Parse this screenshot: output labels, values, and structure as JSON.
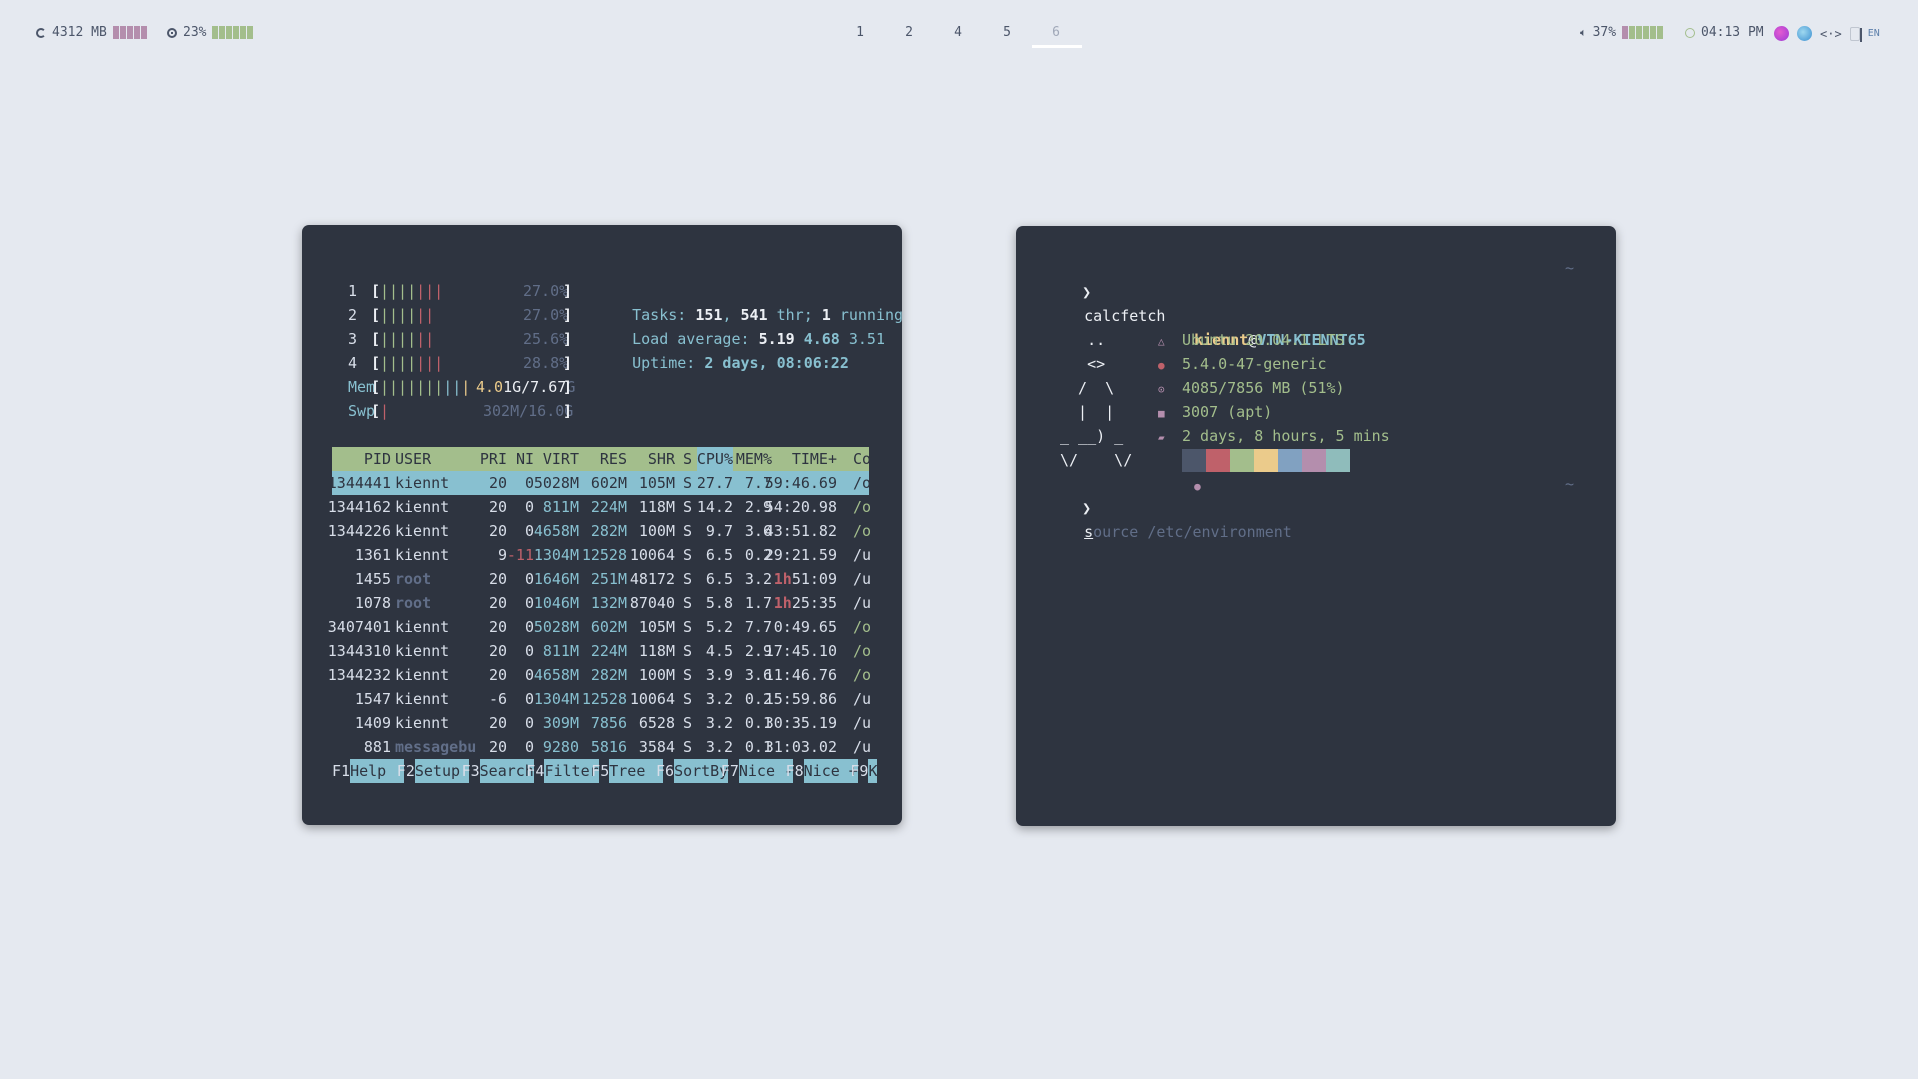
{
  "topbar": {
    "memory": {
      "icon": "memory-icon",
      "label": "4312 MB"
    },
    "cpu": {
      "icon": "cpu-icon",
      "label": "23%"
    },
    "workspaces": [
      "1",
      "2",
      "4",
      "5",
      "6"
    ],
    "active_workspace": "6",
    "volume": {
      "icon": "volume-icon",
      "label": "37%"
    },
    "clock": {
      "icon": "clock-icon",
      "label": "04:13 PM"
    },
    "tray_icons": [
      "firefox-icon",
      "globe-icon",
      "network-icon",
      "battery-icon"
    ],
    "keyboard_layout": "EN"
  },
  "htop": {
    "cpu_meters": [
      {
        "id": "1",
        "percent": "27.0%"
      },
      {
        "id": "2",
        "percent": "27.0%"
      },
      {
        "id": "3",
        "percent": "25.6%"
      },
      {
        "id": "4",
        "percent": "28.8%"
      }
    ],
    "mem_label": "Mem",
    "mem_value_a": "4.0",
    "mem_value_b": "1G/7.67",
    "mem_value_c": "G",
    "swp_label": "Swp",
    "swp_value": "302M/16.0G",
    "tasks_label": "Tasks: ",
    "tasks_total": "151",
    "tasks_thr": "541",
    "tasks_thr_label": " thr; ",
    "tasks_running": "1",
    "tasks_running_label": " running",
    "load_label": "Load average: ",
    "load_1": "5.19",
    "load_5": "4.68",
    "load_15": "3.51",
    "uptime_label": "Uptime: ",
    "uptime_value": "2 days, 08:06:22",
    "columns": [
      "PID",
      "USER",
      "PRI",
      "NI",
      "VIRT",
      "RES",
      "SHR",
      "S",
      "CPU%",
      "MEM%",
      "TIME+",
      "Co"
    ],
    "processes": [
      {
        "pid": "1344441",
        "user": "kiennt",
        "pri": "20",
        "ni": "0",
        "virt": "5028M",
        "res": "602M",
        "shr": "105M",
        "s": "S",
        "cpu": "27.7",
        "mem": "7.7",
        "time": "59:46.69",
        "cmd": "/o"
      },
      {
        "pid": "1344162",
        "user": "kiennt",
        "pri": "20",
        "ni": "0",
        "virt": "811M",
        "res": "224M",
        "shr": "118M",
        "s": "S",
        "cpu": "14.2",
        "mem": "2.9",
        "time": "54:20.98",
        "cmd": "/o"
      },
      {
        "pid": "1344226",
        "user": "kiennt",
        "pri": "20",
        "ni": "0",
        "virt": "4658M",
        "res": "282M",
        "shr": "100M",
        "s": "S",
        "cpu": "9.7",
        "mem": "3.6",
        "time": "43:51.82",
        "cmd": "/o"
      },
      {
        "pid": "1361",
        "user": "kiennt",
        "pri": "9",
        "ni": "-11",
        "virt": "1304M",
        "res": "12528",
        "shr": "10064",
        "s": "S",
        "cpu": "6.5",
        "mem": "0.2",
        "time": "29:21.59",
        "cmd": "/u"
      },
      {
        "pid": "1455",
        "user": "root",
        "pri": "20",
        "ni": "0",
        "virt": "1646M",
        "res": "251M",
        "shr": "48172",
        "s": "S",
        "cpu": "6.5",
        "mem": "3.2",
        "time_h": "1h",
        "time": "51:09",
        "cmd": "/u"
      },
      {
        "pid": "1078",
        "user": "root",
        "pri": "20",
        "ni": "0",
        "virt": "1046M",
        "res": "132M",
        "shr": "87040",
        "s": "S",
        "cpu": "5.8",
        "mem": "1.7",
        "time_h": "1h",
        "time": "25:35",
        "cmd": "/u"
      },
      {
        "pid": "3407401",
        "user": "kiennt",
        "pri": "20",
        "ni": "0",
        "virt": "5028M",
        "res": "602M",
        "shr": "105M",
        "s": "S",
        "cpu": "5.2",
        "mem": "7.7",
        "time": "0:49.65",
        "cmd": "/o"
      },
      {
        "pid": "1344310",
        "user": "kiennt",
        "pri": "20",
        "ni": "0",
        "virt": "811M",
        "res": "224M",
        "shr": "118M",
        "s": "S",
        "cpu": "4.5",
        "mem": "2.9",
        "time": "17:45.10",
        "cmd": "/o"
      },
      {
        "pid": "1344232",
        "user": "kiennt",
        "pri": "20",
        "ni": "0",
        "virt": "4658M",
        "res": "282M",
        "shr": "100M",
        "s": "S",
        "cpu": "3.9",
        "mem": "3.6",
        "time": "11:46.76",
        "cmd": "/o"
      },
      {
        "pid": "1547",
        "user": "kiennt",
        "pri": "-6",
        "ni": "0",
        "virt": "1304M",
        "res": "12528",
        "shr": "10064",
        "s": "S",
        "cpu": "3.2",
        "mem": "0.2",
        "time": "15:59.86",
        "cmd": "/u"
      },
      {
        "pid": "1409",
        "user": "kiennt",
        "pri": "20",
        "ni": "0",
        "virt": "309M",
        "res": "7856",
        "shr": "6528",
        "s": "S",
        "cpu": "3.2",
        "mem": "0.1",
        "time": "30:35.19",
        "cmd": "/u"
      },
      {
        "pid": "881",
        "user": "messagebu",
        "pri": "20",
        "ni": "0",
        "virt": "9280",
        "res": "5816",
        "shr": "3584",
        "s": "S",
        "cpu": "3.2",
        "mem": "0.1",
        "time": "31:03.02",
        "cmd": "/u"
      }
    ],
    "fkeys": [
      {
        "key": "F1",
        "label": "Help  "
      },
      {
        "key": "F2",
        "label": "Setup "
      },
      {
        "key": "F3",
        "label": "Search"
      },
      {
        "key": "F4",
        "label": "Filter"
      },
      {
        "key": "F5",
        "label": "Tree  "
      },
      {
        "key": "F6",
        "label": "SortBy"
      },
      {
        "key": "F7",
        "label": "Nice -"
      },
      {
        "key": "F8",
        "label": "Nice +"
      },
      {
        "key": "F9",
        "label": "K"
      }
    ]
  },
  "calcfetch": {
    "prompt_symbol": "❯",
    "command": "calcfetch",
    "home_marker": "~",
    "ascii_art": [
      "   ..",
      "   <>",
      "  /  \\",
      "  |  |",
      "_ __) _",
      "\\/    \\/"
    ],
    "user": "kiennt",
    "at": "@",
    "host": "VTN-KIENNT65",
    "info": [
      {
        "icon": "os-icon",
        "value": "Ubuntu 20.04.1 LTS"
      },
      {
        "icon": "kernel-icon",
        "value": "5.4.0-47-generic"
      },
      {
        "icon": "memory-icon",
        "value": "4085/7856 MB (51%)"
      },
      {
        "icon": "package-icon",
        "value": "3007 (apt)"
      },
      {
        "icon": "uptime-icon",
        "value": "2 days, 8 hours, 5 mins"
      }
    ],
    "palette_icon": "palette-icon",
    "palette": [
      "#4c566a",
      "#bf616a",
      "#a3be8c",
      "#ebcb8b",
      "#81a1c1",
      "#b48ead",
      "#8fbcbb"
    ],
    "prompt2_typed": "s",
    "prompt2_suggestion": "ource /etc/environment",
    "prompt2_home_marker": "~"
  },
  "colors": {
    "background": "#e5e9f0",
    "terminal_bg": "#2e3440",
    "header_green": "#a3be8c",
    "highlight_cyan": "#88c0d0"
  }
}
